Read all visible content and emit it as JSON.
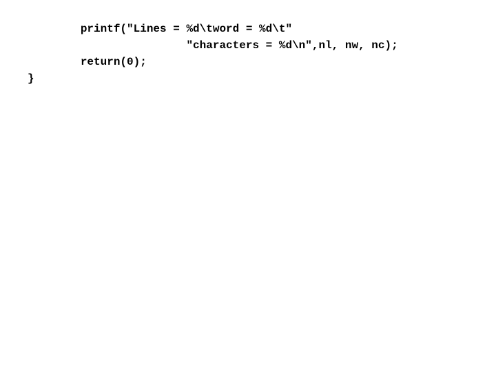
{
  "code": {
    "line1": "        printf(\"Lines = %d\\tword = %d\\t\"",
    "line2": "                        \"characters = %d\\n\",nl, nw, nc);",
    "line3": "        return(0);",
    "line4": "}"
  }
}
